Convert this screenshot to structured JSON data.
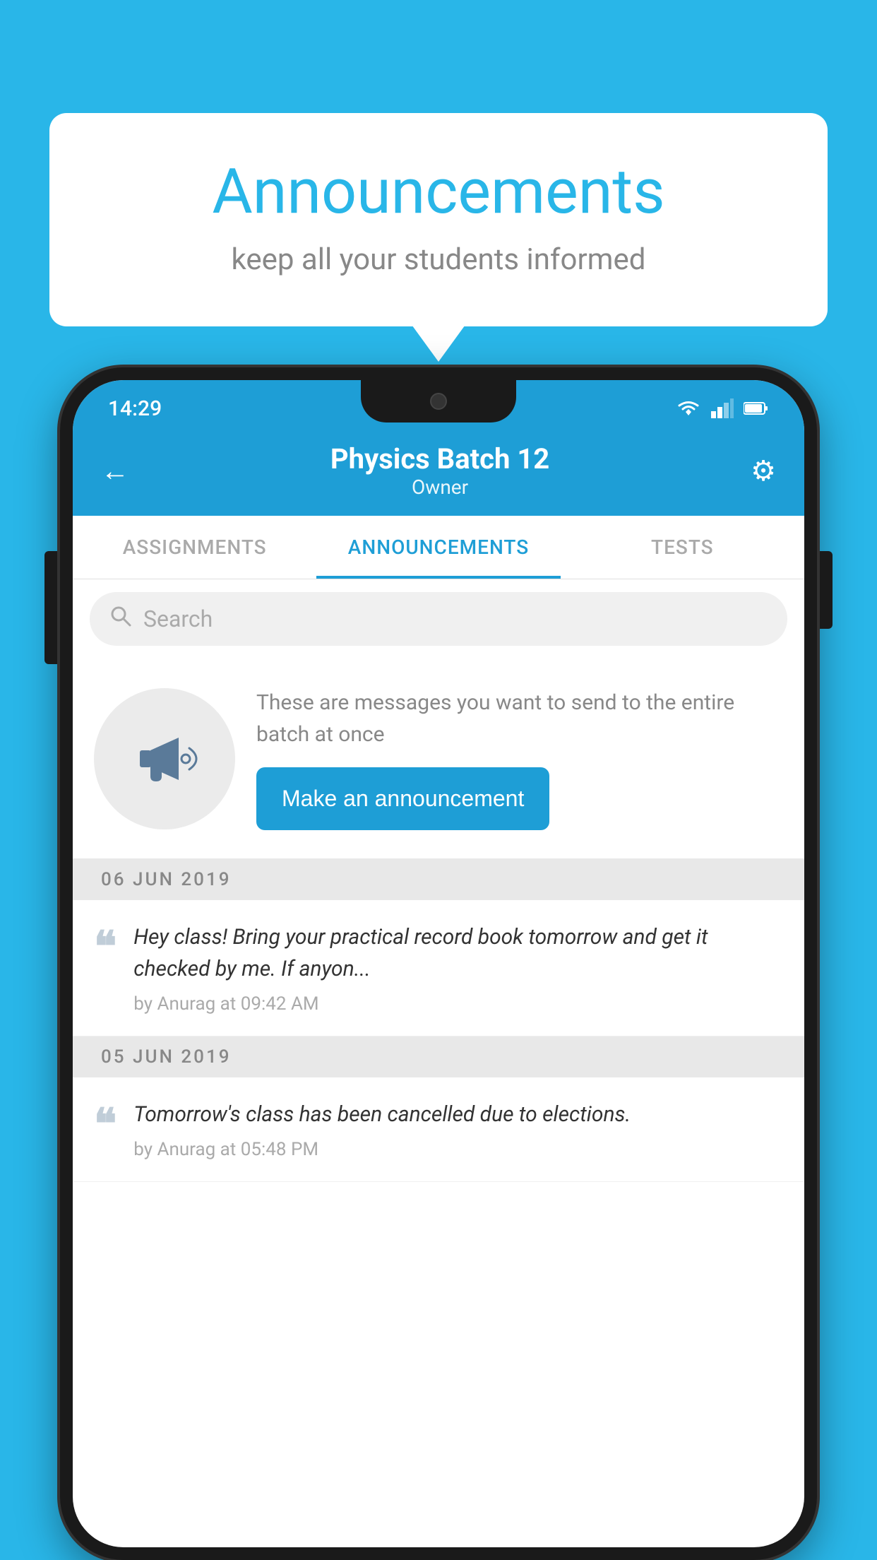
{
  "background_color": "#29b6e8",
  "bubble": {
    "title": "Announcements",
    "subtitle": "keep all your students informed"
  },
  "phone": {
    "status": {
      "time": "14:29",
      "wifi_icon": "wifi",
      "signal_icon": "signal",
      "battery_icon": "battery"
    },
    "header": {
      "back_label": "←",
      "title": "Physics Batch 12",
      "subtitle": "Owner",
      "settings_label": "⚙"
    },
    "tabs": [
      {
        "label": "ASSIGNMENTS",
        "active": false
      },
      {
        "label": "ANNOUNCEMENTS",
        "active": true
      },
      {
        "label": "TESTS",
        "active": false
      },
      {
        "label": "...",
        "active": false
      }
    ],
    "search": {
      "placeholder": "Search"
    },
    "promo": {
      "description": "These are messages you want to send to the entire batch at once",
      "button_label": "Make an announcement"
    },
    "announcements": [
      {
        "date": "06  JUN  2019",
        "text": "Hey class! Bring your practical record book tomorrow and get it checked by me. If anyon...",
        "meta": "by Anurag at 09:42 AM"
      },
      {
        "date": "05  JUN  2019",
        "text": "Tomorrow's class has been cancelled due to elections.",
        "meta": "by Anurag at 05:48 PM"
      }
    ]
  }
}
